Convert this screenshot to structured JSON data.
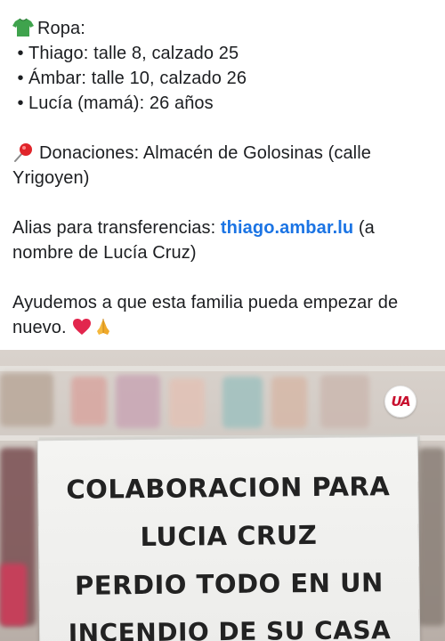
{
  "post": {
    "ropa_label": "Ropa:",
    "bullets": [
      "Thiago: talle 8, calzado 25",
      "Ámbar: talle 10, calzado 26",
      "Lucía (mamá): 26 años"
    ],
    "bullet_char": "•",
    "donaciones_text": "Donaciones: Almacén de Golosinas (calle",
    "donaciones_text_2": "Yrigoyen)",
    "alias_prefix": "Alias para transferencias: ",
    "alias_link": "thiago.ambar.lu",
    "alias_suffix": " (a",
    "alias_line_2": "nombre de Lucía Cruz)",
    "closing_line_1": "Ayudemos a que esta familia pueda empezar de",
    "closing_line_2": "nuevo.",
    "icons": [
      "shirt-icon",
      "pushpin-icon",
      "red-heart-icon",
      "praying-hands-icon"
    ]
  },
  "photo": {
    "logo_text": "UA",
    "sign_lines": [
      "COLABORACION PARA",
      "LUCIA CRUZ",
      "PERDIO TODO EN UN",
      "INCENDIO DE SU CASA"
    ]
  },
  "colors": {
    "link": "#1b74e4",
    "text": "#1c1e21",
    "logo_red": "#c8102e"
  }
}
